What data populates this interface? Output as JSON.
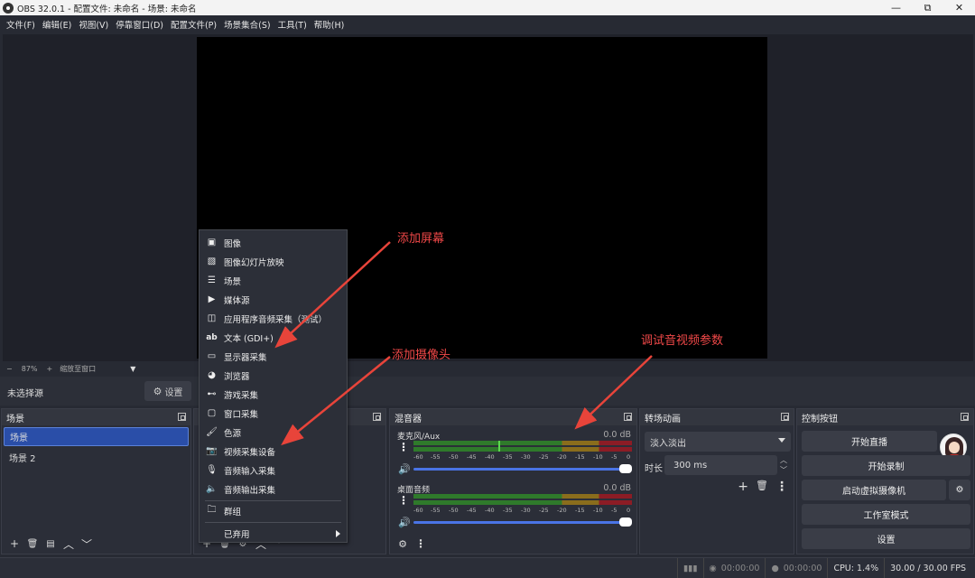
{
  "window": {
    "title": "OBS 32.0.1 - 配置文件: 未命名 - 场景: 未命名",
    "controls": [
      "—",
      "⧉",
      "✕"
    ]
  },
  "menu": [
    "文件(F)",
    "编辑(E)",
    "视图(V)",
    "停靠窗口(D)",
    "配置文件(P)",
    "场景集合(S)",
    "工具(T)",
    "帮助(H)"
  ],
  "zoom": {
    "minus": "−",
    "value": "87%",
    "plus": "+",
    "fit_label": "缩放至窗口",
    "dropdown": "▼"
  },
  "source_bar": {
    "no_source": "未选择源",
    "settings_label": "设置"
  },
  "scenes": {
    "title": "场景",
    "items": [
      {
        "label": "场景",
        "selected": true
      },
      {
        "label": "场景 2",
        "selected": false
      }
    ],
    "toolbar": [
      "+",
      "🗑",
      "▤",
      "︿",
      "﹀"
    ]
  },
  "sources": {
    "toolbar": [
      "+",
      "🗑",
      "⚙",
      "︿",
      "﹀"
    ]
  },
  "mixer": {
    "title": "混音器",
    "channels": [
      {
        "name": "麦克风/Aux",
        "db": "0.0 dB"
      },
      {
        "name": "桌面音频",
        "db": "0.0 dB"
      }
    ],
    "scale": [
      "-60",
      "-55",
      "-50",
      "-45",
      "-40",
      "-35",
      "-30",
      "-25",
      "-20",
      "-15",
      "-10",
      "-5",
      "0"
    ]
  },
  "transitions": {
    "title": "转场动画",
    "selected": "淡入淡出",
    "duration_label": "时长",
    "duration_value": "300 ms"
  },
  "controls": {
    "title": "控制按钮",
    "buttons": [
      "开始直播",
      "开始录制",
      "启动虚拟摄像机",
      "工作室模式",
      "设置"
    ]
  },
  "status": {
    "stream_time": "00:00:00",
    "rec_time": "00:00:00",
    "cpu": "CPU: 1.4%",
    "fps": "30.00 / 30.00 FPS"
  },
  "context_menu": {
    "items": [
      {
        "label": "图像",
        "icon": "image-icon"
      },
      {
        "label": "图像幻灯片放映",
        "icon": "slideshow-icon"
      },
      {
        "label": "场景",
        "icon": "list-icon"
      },
      {
        "label": "媒体源",
        "icon": "play-icon"
      },
      {
        "label": "应用程序音频采集（测试）",
        "icon": "app-audio-icon"
      },
      {
        "label": "文本 (GDI+)",
        "icon": "text-icon"
      },
      {
        "label": "显示器采集",
        "icon": "monitor-icon"
      },
      {
        "label": "浏览器",
        "icon": "globe-icon"
      },
      {
        "label": "游戏采集",
        "icon": "gamepad-icon"
      },
      {
        "label": "窗口采集",
        "icon": "window-icon"
      },
      {
        "label": "色源",
        "icon": "brush-icon"
      },
      {
        "label": "视频采集设备",
        "icon": "camera-icon"
      },
      {
        "label": "音频输入采集",
        "icon": "mic-icon"
      },
      {
        "label": "音频输出采集",
        "icon": "speaker-icon"
      }
    ],
    "group": "群组",
    "deprecated": "已弃用"
  },
  "annotations": {
    "screen": "添加屏幕",
    "camera": "添加摄像头",
    "av_params": "调试音视频参数"
  },
  "colors": {
    "accent_blue": "#2a4ea8",
    "annotation_red": "#e8443a",
    "meter_green": "#2f7a2b",
    "meter_yellow": "#8a6d1c",
    "meter_red": "#8c1c25"
  }
}
